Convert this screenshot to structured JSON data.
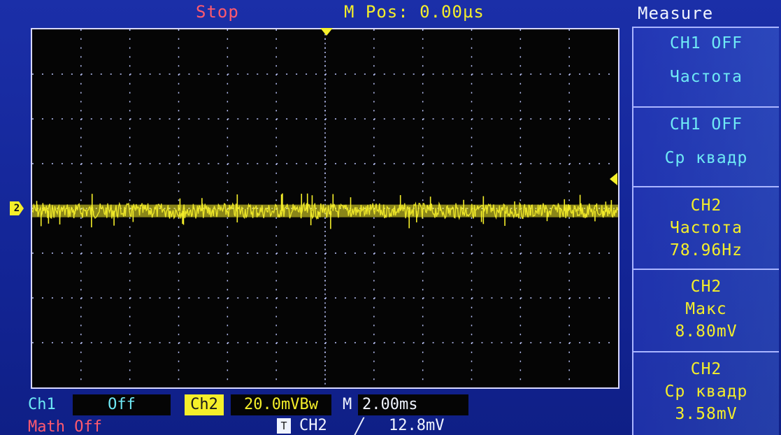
{
  "header": {
    "run_state": "Stop",
    "m_pos": "M Pos: 0.00µs"
  },
  "screen": {
    "ch2_marker": "2",
    "waveform_color": "#f5ef2a",
    "trace": {
      "description_level": "slight positive offset noise band",
      "band_level_div": 0.1
    }
  },
  "measure": {
    "title": "Measure",
    "items": [
      {
        "line1": "CH1 OFF",
        "line2": "Частота",
        "line3": ""
      },
      {
        "line1": "CH1 OFF",
        "line2": "Ср  квадр",
        "line3": ""
      },
      {
        "line1": "CH2",
        "line2": "Частота",
        "line3": "78.96Hz"
      },
      {
        "line1": "CH2",
        "line2": "Макс",
        "line3": "8.80mV"
      },
      {
        "line1": "CH2",
        "line2": "Ср  квадр",
        "line3": "3.58mV"
      }
    ]
  },
  "bottom": {
    "ch1_label": "Ch1",
    "ch1_value": "Off",
    "ch2_label": "Ch2",
    "ch2_value": "20.0mVBw",
    "m_label": "M",
    "m_value": "2.00ms",
    "math": "Math Off",
    "trigger_icon": "T",
    "trigger_source": "CH2",
    "trigger_edge": "rising-edge-icon",
    "trigger_level": "12.8mV"
  }
}
